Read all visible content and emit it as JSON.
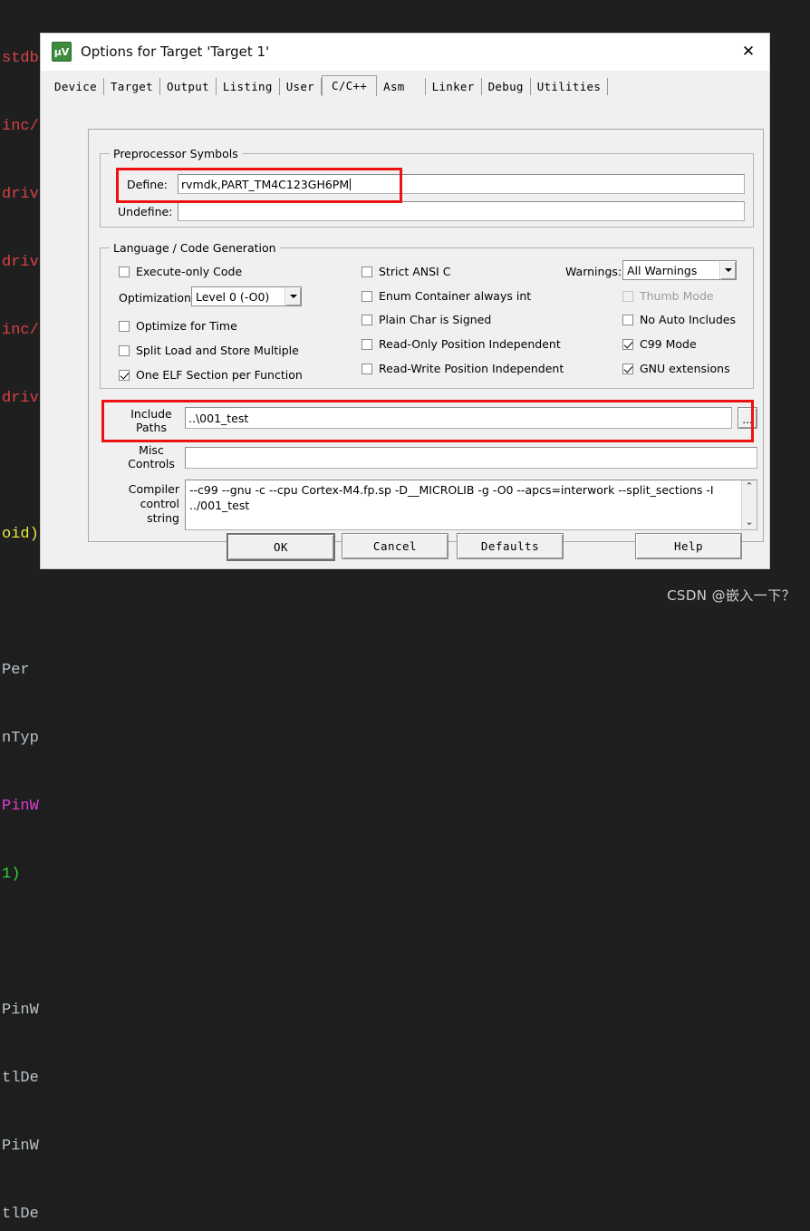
{
  "editor": {
    "lines": [
      {
        "text": "stdbool.h>",
        "color": "red"
      },
      {
        "text": "inc/hw_gpio.h\"",
        "color": "red"
      },
      {
        "text": "driverlib/",
        "color": "red"
      },
      {
        "text": "driverlib/",
        "color": "red"
      },
      {
        "text": "inc/hw_m",
        "color": "red"
      },
      {
        "text": "driverl",
        "color": "red"
      },
      {
        "text": "",
        "color": "grey"
      },
      {
        "text": "oid)",
        "color": "yellow"
      },
      {
        "text": "",
        "color": "grey"
      },
      {
        "text": "Per",
        "color": "grey"
      },
      {
        "text": "nTyp",
        "color": "grey"
      },
      {
        "text": "PinW",
        "color": "pink"
      },
      {
        "text": "1)",
        "color": "green"
      },
      {
        "text": "",
        "color": "grey"
      },
      {
        "text": "PinW",
        "color": "grey"
      },
      {
        "text": "tlDe",
        "color": "grey"
      },
      {
        "text": "PinW",
        "color": "grey"
      },
      {
        "text": "tlDe",
        "color": "grey"
      }
    ]
  },
  "watermark": "CSDN @嵌入一下？",
  "dialog": {
    "title": "Options for Target 'Target 1'",
    "app_icon": "keil-uvision-icon",
    "close_icon": "✕",
    "tabs": [
      {
        "label": "Device",
        "active": false
      },
      {
        "label": "Target",
        "active": false
      },
      {
        "label": "Output",
        "active": false
      },
      {
        "label": "Listing",
        "active": false
      },
      {
        "label": "User",
        "active": false
      },
      {
        "label": "C/C++",
        "active": true
      },
      {
        "label": "Asm",
        "active": false
      },
      {
        "label": "Linker",
        "active": false
      },
      {
        "label": "Debug",
        "active": false
      },
      {
        "label": "Utilities",
        "active": false
      }
    ],
    "preprocessor": {
      "title": "Preprocessor Symbols",
      "define_label": "Define:",
      "define_value": "rvmdk,PART_TM4C123GH6PM",
      "undefine_label": "Undefine:",
      "undefine_value": ""
    },
    "language": {
      "title": "Language / Code Generation",
      "left_column": [
        {
          "label": "Execute-only Code",
          "checked": false,
          "disabled": false
        },
        {
          "label": "Optimize for Time",
          "checked": false,
          "disabled": false
        },
        {
          "label": "Split Load and Store Multiple",
          "checked": false,
          "disabled": false
        },
        {
          "label": "One ELF Section per Function",
          "checked": true,
          "disabled": false
        }
      ],
      "optimization_label": "Optimization:",
      "optimization_value": "Level 0 (-O0)",
      "middle_column": [
        {
          "label": "Strict ANSI C",
          "checked": false,
          "disabled": false
        },
        {
          "label": "Enum Container always int",
          "checked": false,
          "disabled": false
        },
        {
          "label": "Plain Char is Signed",
          "checked": false,
          "disabled": false
        },
        {
          "label": "Read-Only Position Independent",
          "checked": false,
          "disabled": false
        },
        {
          "label": "Read-Write Position Independent",
          "checked": false,
          "disabled": false
        }
      ],
      "warnings_label": "Warnings:",
      "warnings_value": "All Warnings",
      "right_column": [
        {
          "label": "Thumb Mode",
          "checked": false,
          "disabled": true
        },
        {
          "label": "No Auto Includes",
          "checked": false,
          "disabled": false
        },
        {
          "label": "C99 Mode",
          "checked": true,
          "disabled": false
        },
        {
          "label": "GNU extensions",
          "checked": true,
          "disabled": false
        }
      ]
    },
    "paths": {
      "include_label_line1": "Include",
      "include_label_line2": "Paths",
      "include_value": "..\\001_test",
      "browse_label": "...",
      "misc_label_line1": "Misc",
      "misc_label_line2": "Controls",
      "misc_value": "",
      "compiler_label_line1": "Compiler",
      "compiler_label_line2": "control",
      "compiler_label_line3": "string",
      "compiler_value": "--c99 --gnu -c --cpu Cortex-M4.fp.sp -D__MICROLIB -g -O0 --apcs=interwork --split_sections -I\n../001_test",
      "scroll_up": "⌃",
      "scroll_down": "⌄"
    },
    "buttons": [
      {
        "label": "OK",
        "default": true
      },
      {
        "label": "Cancel",
        "default": false
      },
      {
        "label": "Defaults",
        "default": false
      },
      {
        "label": "Help",
        "default": false
      }
    ],
    "highlight_color": "#ee1111"
  }
}
